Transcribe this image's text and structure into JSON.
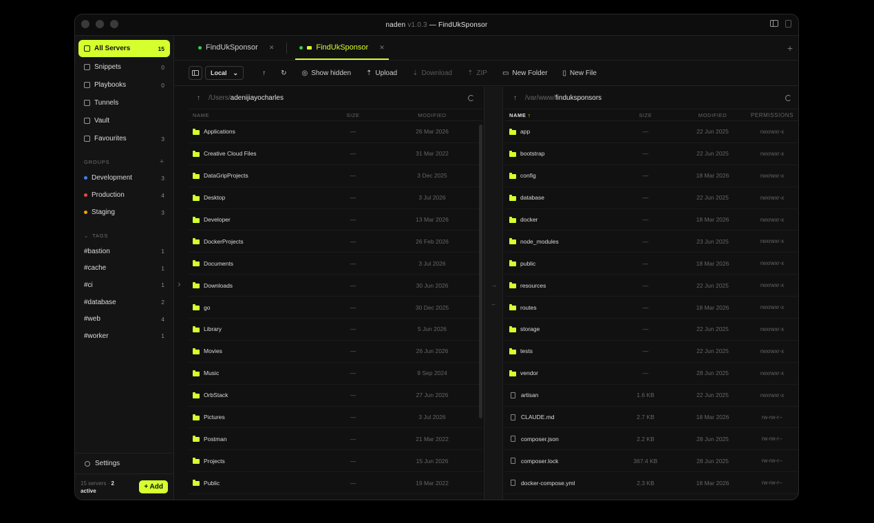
{
  "window": {
    "app": "naden",
    "version": "v1.0.3",
    "separator": "—",
    "project": "FindUkSponsor"
  },
  "sidebar": {
    "nav": [
      {
        "label": "All Servers",
        "count": "15",
        "active": true
      },
      {
        "label": "Snippets",
        "count": "0"
      },
      {
        "label": "Playbooks",
        "count": "0"
      },
      {
        "label": "Tunnels",
        "count": ""
      },
      {
        "label": "Vault",
        "count": ""
      },
      {
        "label": "Favourites",
        "count": "3"
      }
    ],
    "groups_title": "GROUPS",
    "groups": [
      {
        "label": "Development",
        "count": "3",
        "color": "#3b82f6"
      },
      {
        "label": "Production",
        "count": "4",
        "color": "#ef4444"
      },
      {
        "label": "Staging",
        "count": "3",
        "color": "#f59e0b"
      }
    ],
    "tags_title": "TAGS",
    "tags": [
      {
        "label": "#bastion",
        "count": "1"
      },
      {
        "label": "#cache",
        "count": "1"
      },
      {
        "label": "#ci",
        "count": "1"
      },
      {
        "label": "#database",
        "count": "2"
      },
      {
        "label": "#web",
        "count": "4"
      },
      {
        "label": "#worker",
        "count": "1"
      }
    ],
    "settings_label": "Settings",
    "footer": {
      "servers": "15 servers ·",
      "active_count": "2",
      "active_label": "active",
      "add_label": "+ Add"
    }
  },
  "tabs": [
    {
      "label": "FindUkSponsor",
      "active": false
    },
    {
      "label": "FindUkSponsor",
      "active": true
    }
  ],
  "toolbar": {
    "location": "Local",
    "show_hidden": "Show hidden",
    "upload": "Upload",
    "download": "Download",
    "zip": "ZIP",
    "new_folder": "New Folder",
    "new_file": "New File"
  },
  "local_pane": {
    "path_prefix": "/Users/",
    "path_last": "adenijiayocharles",
    "columns": [
      "NAME",
      "SIZE",
      "MODIFIED"
    ],
    "rows": [
      {
        "name": "Applications",
        "size": "—",
        "modified": "26 Mar 2026"
      },
      {
        "name": "Creative Cloud Files",
        "size": "—",
        "modified": "31 Mar 2022"
      },
      {
        "name": "DataGripProjects",
        "size": "—",
        "modified": "3 Dec 2025"
      },
      {
        "name": "Desktop",
        "size": "—",
        "modified": "3 Jul 2026"
      },
      {
        "name": "Developer",
        "size": "—",
        "modified": "13 Mar 2026"
      },
      {
        "name": "DockerProjects",
        "size": "—",
        "modified": "26 Feb 2026"
      },
      {
        "name": "Documents",
        "size": "—",
        "modified": "3 Jul 2026"
      },
      {
        "name": "Downloads",
        "size": "—",
        "modified": "30 Jun 2026"
      },
      {
        "name": "go",
        "size": "—",
        "modified": "30 Dec 2025"
      },
      {
        "name": "Library",
        "size": "—",
        "modified": "5 Jun 2026"
      },
      {
        "name": "Movies",
        "size": "—",
        "modified": "26 Jun 2026"
      },
      {
        "name": "Music",
        "size": "—",
        "modified": "9 Sep 2024"
      },
      {
        "name": "OrbStack",
        "size": "—",
        "modified": "27 Jun 2026"
      },
      {
        "name": "Pictures",
        "size": "—",
        "modified": "3 Jul 2026"
      },
      {
        "name": "Postman",
        "size": "—",
        "modified": "21 Mar 2022"
      },
      {
        "name": "Projects",
        "size": "—",
        "modified": "15 Jun 2026"
      },
      {
        "name": "Public",
        "size": "—",
        "modified": "19 Mar 2022"
      }
    ]
  },
  "remote_pane": {
    "path_prefix": "/var/www/",
    "path_last": "finduksponsors",
    "columns": [
      "NAME",
      "SIZE",
      "MODIFIED",
      "PERMISSIONS"
    ],
    "sort_arrow": "↑",
    "rows": [
      {
        "name": "app",
        "type": "folder",
        "size": "—",
        "modified": "22 Jun 2025",
        "perm": "rwxrwxr-x"
      },
      {
        "name": "bootstrap",
        "type": "folder",
        "size": "—",
        "modified": "22 Jun 2025",
        "perm": "rwxrwxr-x"
      },
      {
        "name": "config",
        "type": "folder",
        "size": "—",
        "modified": "18 Mar 2026",
        "perm": "rwxrwxr-x"
      },
      {
        "name": "database",
        "type": "folder",
        "size": "—",
        "modified": "22 Jun 2025",
        "perm": "rwxrwxr-x"
      },
      {
        "name": "docker",
        "type": "folder",
        "size": "—",
        "modified": "18 Mar 2026",
        "perm": "rwxrwxr-x"
      },
      {
        "name": "node_modules",
        "type": "folder",
        "size": "—",
        "modified": "23 Jun 2025",
        "perm": "rwxrwxr-x"
      },
      {
        "name": "public",
        "type": "folder",
        "size": "—",
        "modified": "18 Mar 2026",
        "perm": "rwxrwxr-x"
      },
      {
        "name": "resources",
        "type": "folder",
        "size": "—",
        "modified": "22 Jun 2025",
        "perm": "rwxrwxr-x"
      },
      {
        "name": "routes",
        "type": "folder",
        "size": "—",
        "modified": "18 Mar 2026",
        "perm": "rwxrwxr-x"
      },
      {
        "name": "storage",
        "type": "folder",
        "size": "—",
        "modified": "22 Jun 2025",
        "perm": "rwxrwxr-x"
      },
      {
        "name": "tests",
        "type": "folder",
        "size": "—",
        "modified": "22 Jun 2025",
        "perm": "rwxrwxr-x"
      },
      {
        "name": "vendor",
        "type": "folder",
        "size": "—",
        "modified": "28 Jun 2025",
        "perm": "rwxrwxr-x"
      },
      {
        "name": "artisan",
        "type": "file",
        "size": "1.6 KB",
        "modified": "22 Jun 2025",
        "perm": "rwxrwxr-x"
      },
      {
        "name": "CLAUDE.md",
        "type": "file",
        "size": "2.7 KB",
        "modified": "18 Mar 2026",
        "perm": "rw-rw-r--"
      },
      {
        "name": "composer.json",
        "type": "file",
        "size": "2.2 KB",
        "modified": "28 Jun 2025",
        "perm": "rw-rw-r--"
      },
      {
        "name": "composer.lock",
        "type": "file",
        "size": "367.4 KB",
        "modified": "28 Jun 2025",
        "perm": "rw-rw-r--"
      },
      {
        "name": "docker-compose.yml",
        "type": "file",
        "size": "2.3 KB",
        "modified": "18 Mar 2026",
        "perm": "rw-rw-r--"
      }
    ]
  },
  "colors": {
    "accent": "#d6ff2e",
    "status_online": "#35d04a"
  }
}
